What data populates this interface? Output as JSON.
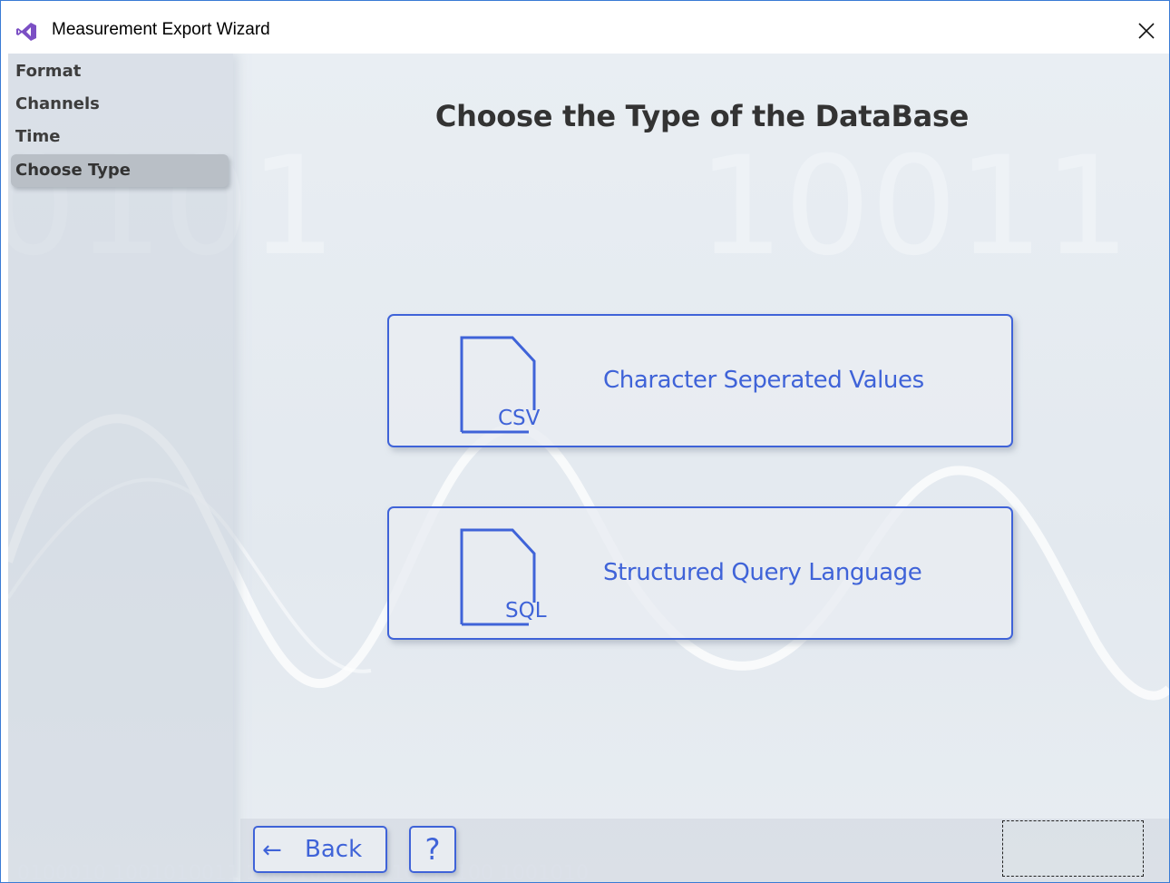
{
  "window": {
    "title": "Measurement Export Wizard",
    "close_glyph": "✕"
  },
  "sidebar": {
    "items": [
      {
        "label": "Format",
        "active": false
      },
      {
        "label": "Channels",
        "active": false
      },
      {
        "label": "Time",
        "active": false
      },
      {
        "label": "Choose Type",
        "active": true
      }
    ]
  },
  "main": {
    "heading": "Choose the Type of the DataBase",
    "options": [
      {
        "tag": "CSV",
        "label": "Character Seperated Values",
        "icon": "csv-file-icon"
      },
      {
        "tag": "SQL",
        "label": "Structured Query Language",
        "icon": "sql-file-icon"
      }
    ]
  },
  "footer": {
    "back_arrow": "←",
    "back_label": "Back",
    "help_label": "?"
  },
  "colors": {
    "accent": "#3f63d8",
    "window_border": "#3a7bd5",
    "sidebar_active": "#b9bfc6",
    "text_dark": "#333333"
  }
}
